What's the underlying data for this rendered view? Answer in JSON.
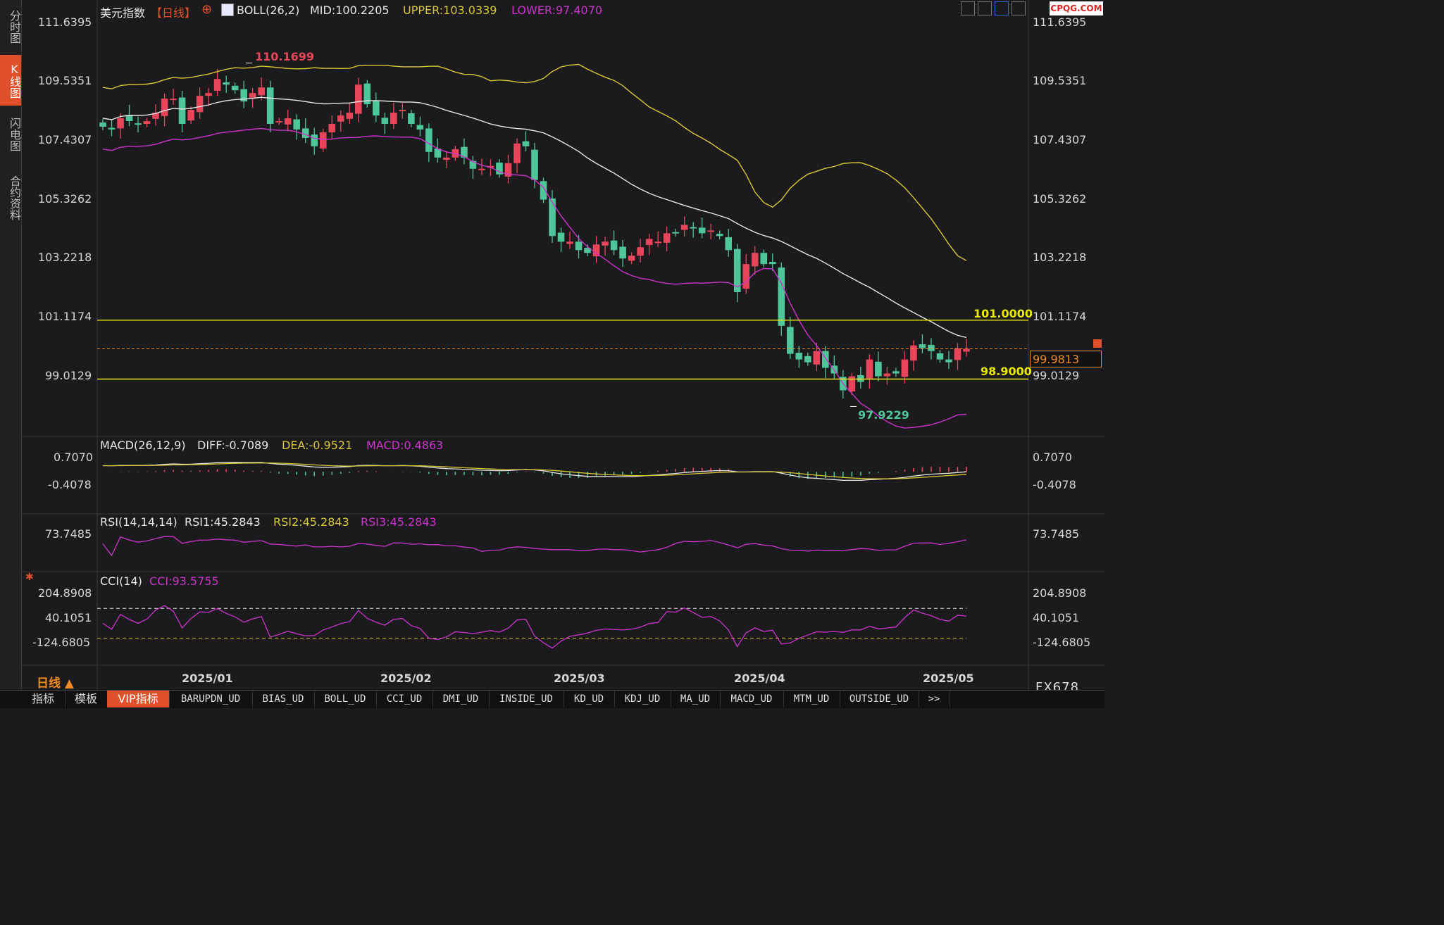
{
  "sidebar": {
    "tabs": [
      {
        "label": "分时图",
        "active": false
      },
      {
        "label": "K线图",
        "active": true
      },
      {
        "label": "闪电图",
        "active": false
      },
      {
        "label": "合约资料",
        "active": false
      }
    ]
  },
  "header": {
    "title": "美元指数",
    "period": "【日线】",
    "add_symbol": "⊕",
    "boll": {
      "name": "BOLL(26,2)",
      "mid": "MID:100.2205",
      "upper": "UPPER:103.0339",
      "lower": "LOWER:97.4070"
    }
  },
  "toolbar": {
    "icons": [
      "grid-layout-icon",
      "bar-chart-icon",
      "line-chart-icon",
      "expand-chart-icon"
    ]
  },
  "watermark": "CPQG.COM",
  "price_pane": {
    "yticks": [
      "111.6395",
      "109.5351",
      "107.4307",
      "105.3262",
      "103.2218",
      "101.1174",
      "99.0129"
    ],
    "high_label": "110.1699",
    "low_label": "97.9229",
    "levels": [
      {
        "label": "101.0000",
        "value": 101.0
      },
      {
        "label": "98.9000",
        "value": 98.9
      }
    ],
    "last_price": "99.9813",
    "last_value": 99.9813
  },
  "macd_pane": {
    "name": "MACD(26,12,9)",
    "diff": "DIFF:-0.7089",
    "dea": "DEA:-0.9521",
    "macd": "MACD:0.4863",
    "yticks": [
      "0.7070",
      "-0.4078"
    ]
  },
  "rsi_pane": {
    "name": "RSI(14,14,14)",
    "rsi1": "RSI1:45.2843",
    "rsi2": "RSI2:45.2843",
    "rsi3": "RSI3:45.2843",
    "yticks": [
      "73.7485"
    ]
  },
  "cci_pane": {
    "name": "CCI(14)",
    "cci": "CCI:93.5755",
    "yticks": [
      "204.8908",
      "40.1051",
      "-124.6805"
    ]
  },
  "xaxis": {
    "labels": [
      "2025/01",
      "2025/02",
      "2025/03",
      "2025/04",
      "2025/05"
    ]
  },
  "period_selector": "日线 ▲",
  "symbol_code": "FX678",
  "bottom_tabs": [
    "指标",
    "模板",
    "VIP指标",
    "BARUPDN_UD",
    "BIAS_UD",
    "BOLL_UD",
    "CCI_UD",
    "DMI_UD",
    "INSIDE_UD",
    "KD_UD",
    "KDJ_UD",
    "MA_UD",
    "MACD_UD",
    "MTM_UD",
    "OUTSIDE_UD",
    ">>"
  ],
  "colors": {
    "up": "#e8455a",
    "down": "#4fc59a",
    "upper": "#d8c836",
    "mid": "#e6e6e6",
    "lower": "#cc33cc",
    "level": "#e8e800",
    "last": "#f08a24"
  },
  "chart_data": [
    {
      "type": "candlestick",
      "title": "美元指数 日线",
      "ylim": [
        96.9,
        112.2
      ],
      "x": [
        "2024-12-20",
        "2024-12-23",
        "2024-12-24",
        "2024-12-26",
        "2024-12-27",
        "2024-12-30",
        "2024-12-31",
        "2025-01-02",
        "2025-01-03",
        "2025-01-06",
        "2025-01-07",
        "2025-01-08",
        "2025-01-09",
        "2025-01-10",
        "2025-01-13",
        "2025-01-14",
        "2025-01-15",
        "2025-01-16",
        "2025-01-17",
        "2025-01-20",
        "2025-01-21",
        "2025-01-22",
        "2025-01-23",
        "2025-01-24",
        "2025-01-27",
        "2025-01-28",
        "2025-01-29",
        "2025-01-30",
        "2025-01-31",
        "2025-02-03",
        "2025-02-04",
        "2025-02-05",
        "2025-02-06",
        "2025-02-07",
        "2025-02-10",
        "2025-02-11",
        "2025-02-12",
        "2025-02-13",
        "2025-02-14",
        "2025-02-17",
        "2025-02-18",
        "2025-02-19",
        "2025-02-20",
        "2025-02-21",
        "2025-02-24",
        "2025-02-25",
        "2025-02-26",
        "2025-02-27",
        "2025-02-28",
        "2025-03-03",
        "2025-03-04",
        "2025-03-05",
        "2025-03-06",
        "2025-03-07",
        "2025-03-10",
        "2025-03-11",
        "2025-03-12",
        "2025-03-13",
        "2025-03-14",
        "2025-03-17",
        "2025-03-18",
        "2025-03-19",
        "2025-03-20",
        "2025-03-21",
        "2025-03-24",
        "2025-03-25",
        "2025-03-26",
        "2025-03-27",
        "2025-03-28",
        "2025-03-31",
        "2025-04-01",
        "2025-04-02",
        "2025-04-03",
        "2025-04-04",
        "2025-04-07",
        "2025-04-08",
        "2025-04-09",
        "2025-04-10",
        "2025-04-11",
        "2025-04-14",
        "2025-04-15",
        "2025-04-16",
        "2025-04-17",
        "2025-04-18",
        "2025-04-21",
        "2025-04-22",
        "2025-04-23",
        "2025-04-24",
        "2025-04-25",
        "2025-04-28",
        "2025-04-29",
        "2025-04-30",
        "2025-05-01",
        "2025-05-02",
        "2025-05-05",
        "2025-05-06",
        "2025-05-07",
        "2025-05-08",
        "2025-05-09"
      ],
      "close": [
        107.9,
        107.8,
        108.2,
        108.1,
        108.0,
        108.1,
        108.4,
        108.9,
        108.9,
        108.0,
        108.5,
        109.0,
        109.1,
        109.6,
        109.4,
        109.2,
        108.8,
        109.1,
        109.3,
        108.0,
        108.1,
        108.2,
        107.8,
        107.5,
        107.2,
        107.7,
        108.0,
        108.3,
        108.4,
        109.4,
        108.7,
        108.3,
        108.0,
        108.4,
        108.5,
        108.0,
        107.8,
        107.0,
        106.8,
        106.8,
        107.1,
        106.8,
        106.4,
        106.4,
        106.5,
        106.2,
        106.6,
        107.3,
        107.2,
        106.0,
        105.3,
        104.0,
        103.8,
        103.8,
        103.5,
        103.4,
        103.7,
        103.8,
        103.5,
        103.2,
        103.3,
        103.6,
        103.9,
        103.8,
        104.1,
        104.1,
        104.4,
        104.3,
        104.1,
        104.2,
        104.0,
        103.5,
        102.0,
        103.0,
        103.4,
        103.0,
        103.0,
        100.8,
        99.8,
        99.6,
        99.5,
        99.9,
        99.3,
        99.1,
        98.5,
        99.0,
        98.8,
        99.6,
        99.0,
        99.1,
        99.1,
        99.6,
        100.1,
        100.0,
        99.9,
        99.6,
        99.5,
        100.0,
        99.98
      ],
      "bollinger": {
        "mid": 100.2205,
        "upper": 103.0339,
        "lower": 97.407
      },
      "high_mark": 110.1699,
      "low_mark": 97.9229
    },
    {
      "type": "line",
      "title": "MACD(26,12,9)",
      "series": [
        {
          "name": "DIFF",
          "last": -0.7089
        },
        {
          "name": "DEA",
          "last": -0.9521
        },
        {
          "name": "MACD",
          "last": 0.4863
        }
      ],
      "yticks": [
        0.707,
        -0.4078
      ]
    },
    {
      "type": "line",
      "title": "RSI(14,14,14)",
      "series": [
        {
          "name": "RSI1",
          "last": 45.2843
        },
        {
          "name": "RSI2",
          "last": 45.2843
        },
        {
          "name": "RSI3",
          "last": 45.2843
        }
      ],
      "yticks": [
        73.7485
      ]
    },
    {
      "type": "line",
      "title": "CCI(14)",
      "series": [
        {
          "name": "CCI",
          "last": 93.5755
        }
      ],
      "yticks": [
        204.8908,
        40.1051,
        -124.6805
      ]
    }
  ]
}
